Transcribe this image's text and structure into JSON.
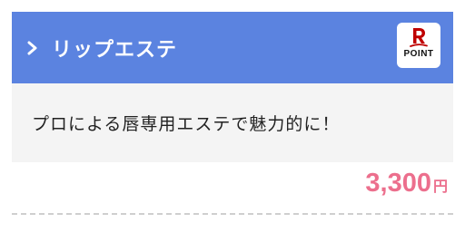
{
  "header": {
    "title": "リップエステ",
    "accent_color": "#5b83e0",
    "chevron_icon": "chevron-right-icon"
  },
  "badge": {
    "logo": "rakuten-r-logo",
    "label": "POINT"
  },
  "description": {
    "text": "プロによる唇専用エステで魅力的に！"
  },
  "price": {
    "amount": "3,300",
    "currency": "円",
    "color": "#ec6f8d"
  }
}
